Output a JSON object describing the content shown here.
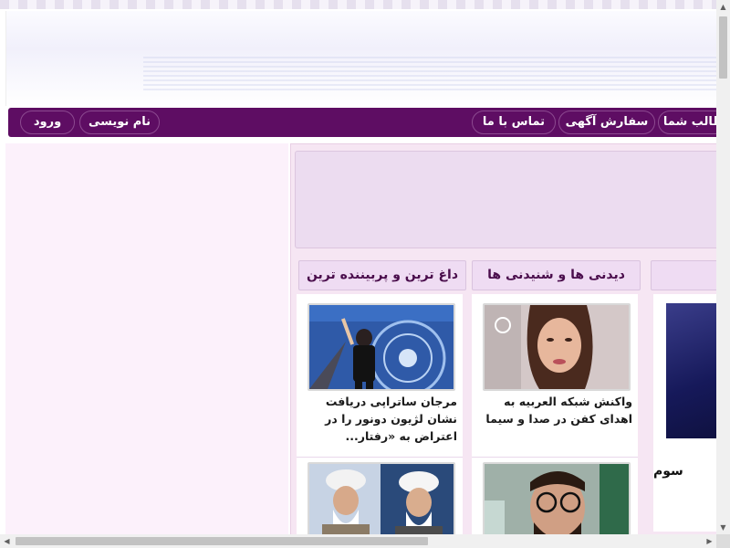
{
  "nav": {
    "login": "ورود",
    "register": "نام نویسی",
    "contact": "تماس با ما",
    "ads": "سفارش آگهی",
    "your_posts": "مطالب شما"
  },
  "sections": {
    "hottest": "داغ ترین و پربیننده ترین",
    "watch_listen": "دیدنی ها و شنیدنی ها"
  },
  "news": {
    "left_1_title": "مرجان ساتراپی دریافت نشان لژیون دونور را در اعتراض به «رفتار...",
    "mid_1_title": "واکنش شبکه العربیه به اهدای کفن در صدا و سیما",
    "featured_title": "سوم"
  },
  "colors": {
    "nav_bg": "#5e0d63",
    "section_bg": "#efdcf3",
    "sidebar_bg": "#fcf1fb"
  },
  "icons": {
    "scroll_up": "▲",
    "scroll_down": "▼",
    "scroll_left": "◀",
    "scroll_right": "▶"
  }
}
